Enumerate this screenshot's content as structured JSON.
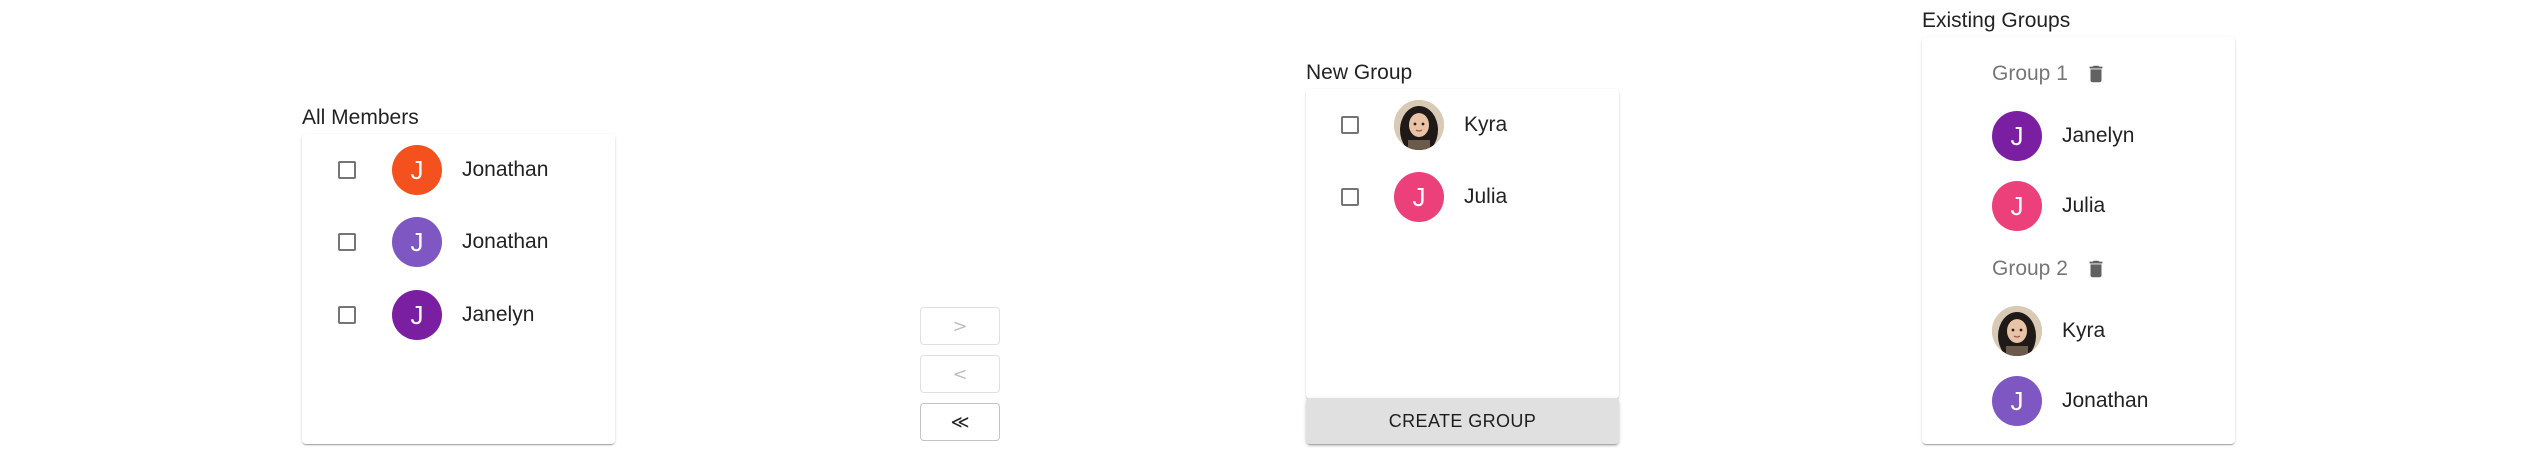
{
  "all_members": {
    "title": "All Members",
    "items": [
      {
        "name": "Jonathan",
        "initial": "J",
        "color": "#f4511e"
      },
      {
        "name": "Jonathan",
        "initial": "J",
        "color": "#7e57c2"
      },
      {
        "name": "Janelyn",
        "initial": "J",
        "color": "#7b1fa2"
      }
    ]
  },
  "transfer": {
    "move_right": ">",
    "move_left": "<",
    "move_all_left": "≪"
  },
  "new_group": {
    "title": "New Group",
    "items": [
      {
        "name": "Kyra",
        "avatar": "photo"
      },
      {
        "name": "Julia",
        "initial": "J",
        "color": "#ec407a"
      }
    ],
    "create_label": "CREATE GROUP"
  },
  "existing_groups": {
    "title": "Existing Groups",
    "groups": [
      {
        "label": "Group 1",
        "members": [
          {
            "name": "Janelyn",
            "initial": "J",
            "color": "#7b1fa2"
          },
          {
            "name": "Julia",
            "initial": "J",
            "color": "#ec407a"
          }
        ]
      },
      {
        "label": "Group 2",
        "members": [
          {
            "name": "Kyra",
            "avatar": "photo"
          },
          {
            "name": "Jonathan",
            "initial": "J",
            "color": "#7e57c2"
          }
        ]
      }
    ]
  }
}
